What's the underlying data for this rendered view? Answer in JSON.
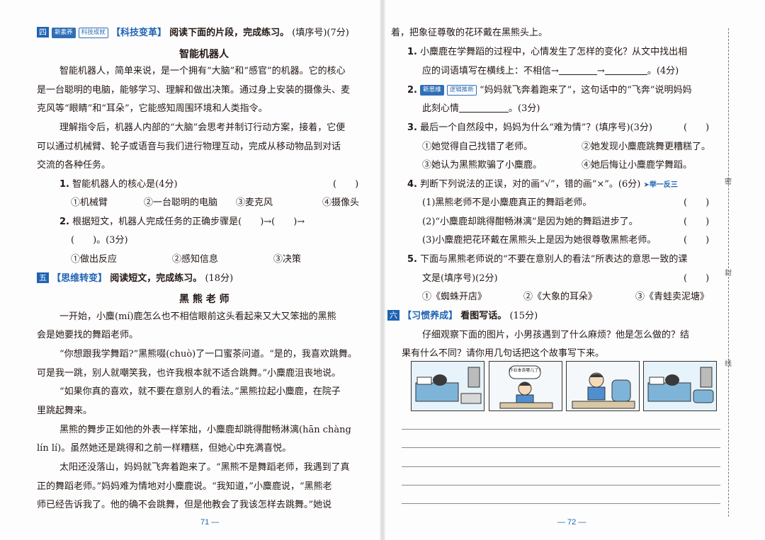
{
  "sec4": {
    "num": "四",
    "tag1": "新素养",
    "tag2": "科技成就",
    "title": "【科技变革】",
    "lead": "阅读下面的片段，完成练习。",
    "note": "(填序号)(7分)",
    "article_title": "智能机器人",
    "p1a": "智能机器人，简单来说，是一个拥有“大脑”和“感官”的机器。它的核心",
    "p1b": "是一台聪明的电脑，能够学习、理解和做出决策。通过身上安装的摄像头、麦",
    "p1c": "克风等“眼睛”和“耳朵”，它能感知周围环境和人类指令。",
    "p2a": "理解指令后，机器人内部的“大脑”会思考并制订行动方案，接着，它便",
    "p2b": "可以通过机械臂、轮子或语音与我们进行物理互动，完成从移动物品到对话",
    "p2c": "交流的各种任务。",
    "q1": {
      "num": "1.",
      "text": "智能机器人的核心是(4分)",
      "paren": "(　　)",
      "opts": [
        "①机械臂",
        "②一台聪明的电脑",
        "③麦克风",
        "④摄像头"
      ]
    },
    "q2": {
      "num": "2.",
      "text": "根据短文，机器人完成任务的正确步骤是(　　)→(　　)→",
      "line2": "(　　)。(3分)",
      "opts": [
        "①做出反应",
        "②感知信息",
        "③决策"
      ]
    }
  },
  "sec5": {
    "num": "五",
    "title": "【思维转变】",
    "lead": "阅读短文，完成练习。",
    "note": "(18分)",
    "article_title": "黑 熊 老 师",
    "lines": [
      "一开始，小麋(mí)鹿怎么也不相信眼前这头看起来又大又笨拙的黑熊",
      "会是她要找的舞蹈老师。",
      "“你想跟我学舞蹈?”黑熊啜(chuò)了一口蜜茶问道。“是的，我喜欢跳舞。",
      "可是我一跳，别人就嘲笑我，也许我根本就不适合跳舞。”小麋鹿沮丧地说。",
      "“如果你真的喜欢，就不要在意别人的看法。”黑熊拉起小麋鹿，在院子",
      "里跳起舞来。",
      "黑熊的舞步正如他的外表一样笨拙，小麋鹿却跳得酣畅淋漓(hān chàng",
      "lín lí)。虽然她还是跳得和之前一样糟糕，但她心中充满喜悦。",
      "太阳还没落山，妈妈就飞奔着跑来了。“黑熊不是舞蹈老师，我遇到了真",
      "正的舞蹈老师。”妈妈难为情地对小麋鹿说。“我知道，”小麋鹿说，“黑熊老",
      "师已经告诉我了。他的确不会跳舞，但是他教会了我该怎样去跳舞。”她说"
    ],
    "cont": "着，把象征尊敬的花环戴在黑熊头上。",
    "q1": {
      "num": "1.",
      "text": "小麋鹿在学舞蹈的过程中，心情发生了怎样的变化？从文中找出相",
      "line2a": "应的词语填写在横线上：不相信→",
      "arrow": "→",
      "end": "。(4分)"
    },
    "q2": {
      "num": "2.",
      "tag": "新思维",
      "tag2": "逻辑推断",
      "text": "“妈妈就飞奔着跑来了”，这句话中的“飞奔”说明妈妈",
      "line2a": "此刻心情",
      "end": "。(3分)"
    },
    "q3": {
      "num": "3.",
      "text": "最后一个自然段中，妈妈为什么“难为情”？(填序号)(3分)",
      "paren": "(　　)",
      "opts": [
        "①她觉得自己找错了老师。",
        "②她发现小麋鹿跳舞更糟糕了。",
        "③她认为黑熊欺骗了小麋鹿。",
        "④她后悔让小麋鹿学舞蹈。"
      ]
    },
    "q4": {
      "num": "4.",
      "text": "判断下列说法的正误，对的画“√”，错的画“×”。(6分)",
      "extra": "➤举一反三",
      "items": [
        "(1)黑熊老师不是小麋鹿真正的舞蹈老师。",
        "(2)“小麋鹿却跳得酣畅淋漓”是因为她的舞蹈进步了。",
        "(3)小麋鹿把花环戴在黑熊头上是因为她很尊敬黑熊老师。"
      ],
      "paren": "(　　)"
    },
    "q5": {
      "num": "5.",
      "text": "下面与黑熊老师说的“不要在意别人的看法”所表达的意思一致的课",
      "line2": "文是(填序号)(2分)",
      "paren": "(　　)",
      "opts": [
        "①《蜘蛛开店》",
        "②《大象的耳朵》",
        "③《青蛙卖泥塘》"
      ]
    }
  },
  "sec6": {
    "num": "六",
    "title": "【习惯养成】",
    "lead": "看图写话。",
    "note": "(15分)",
    "p1": "仔细观察下面的图片，小男孩遇到了什么麻烦？他是怎么做的？结",
    "p2": "果有什么不同？请你用几句话把这个故事写下来。",
    "bubble": "作业本去哪儿了?"
  },
  "page_numbers": {
    "left": "71 —",
    "right": "— 72 —"
  },
  "side_marks": [
    "密",
    "封",
    "线"
  ]
}
